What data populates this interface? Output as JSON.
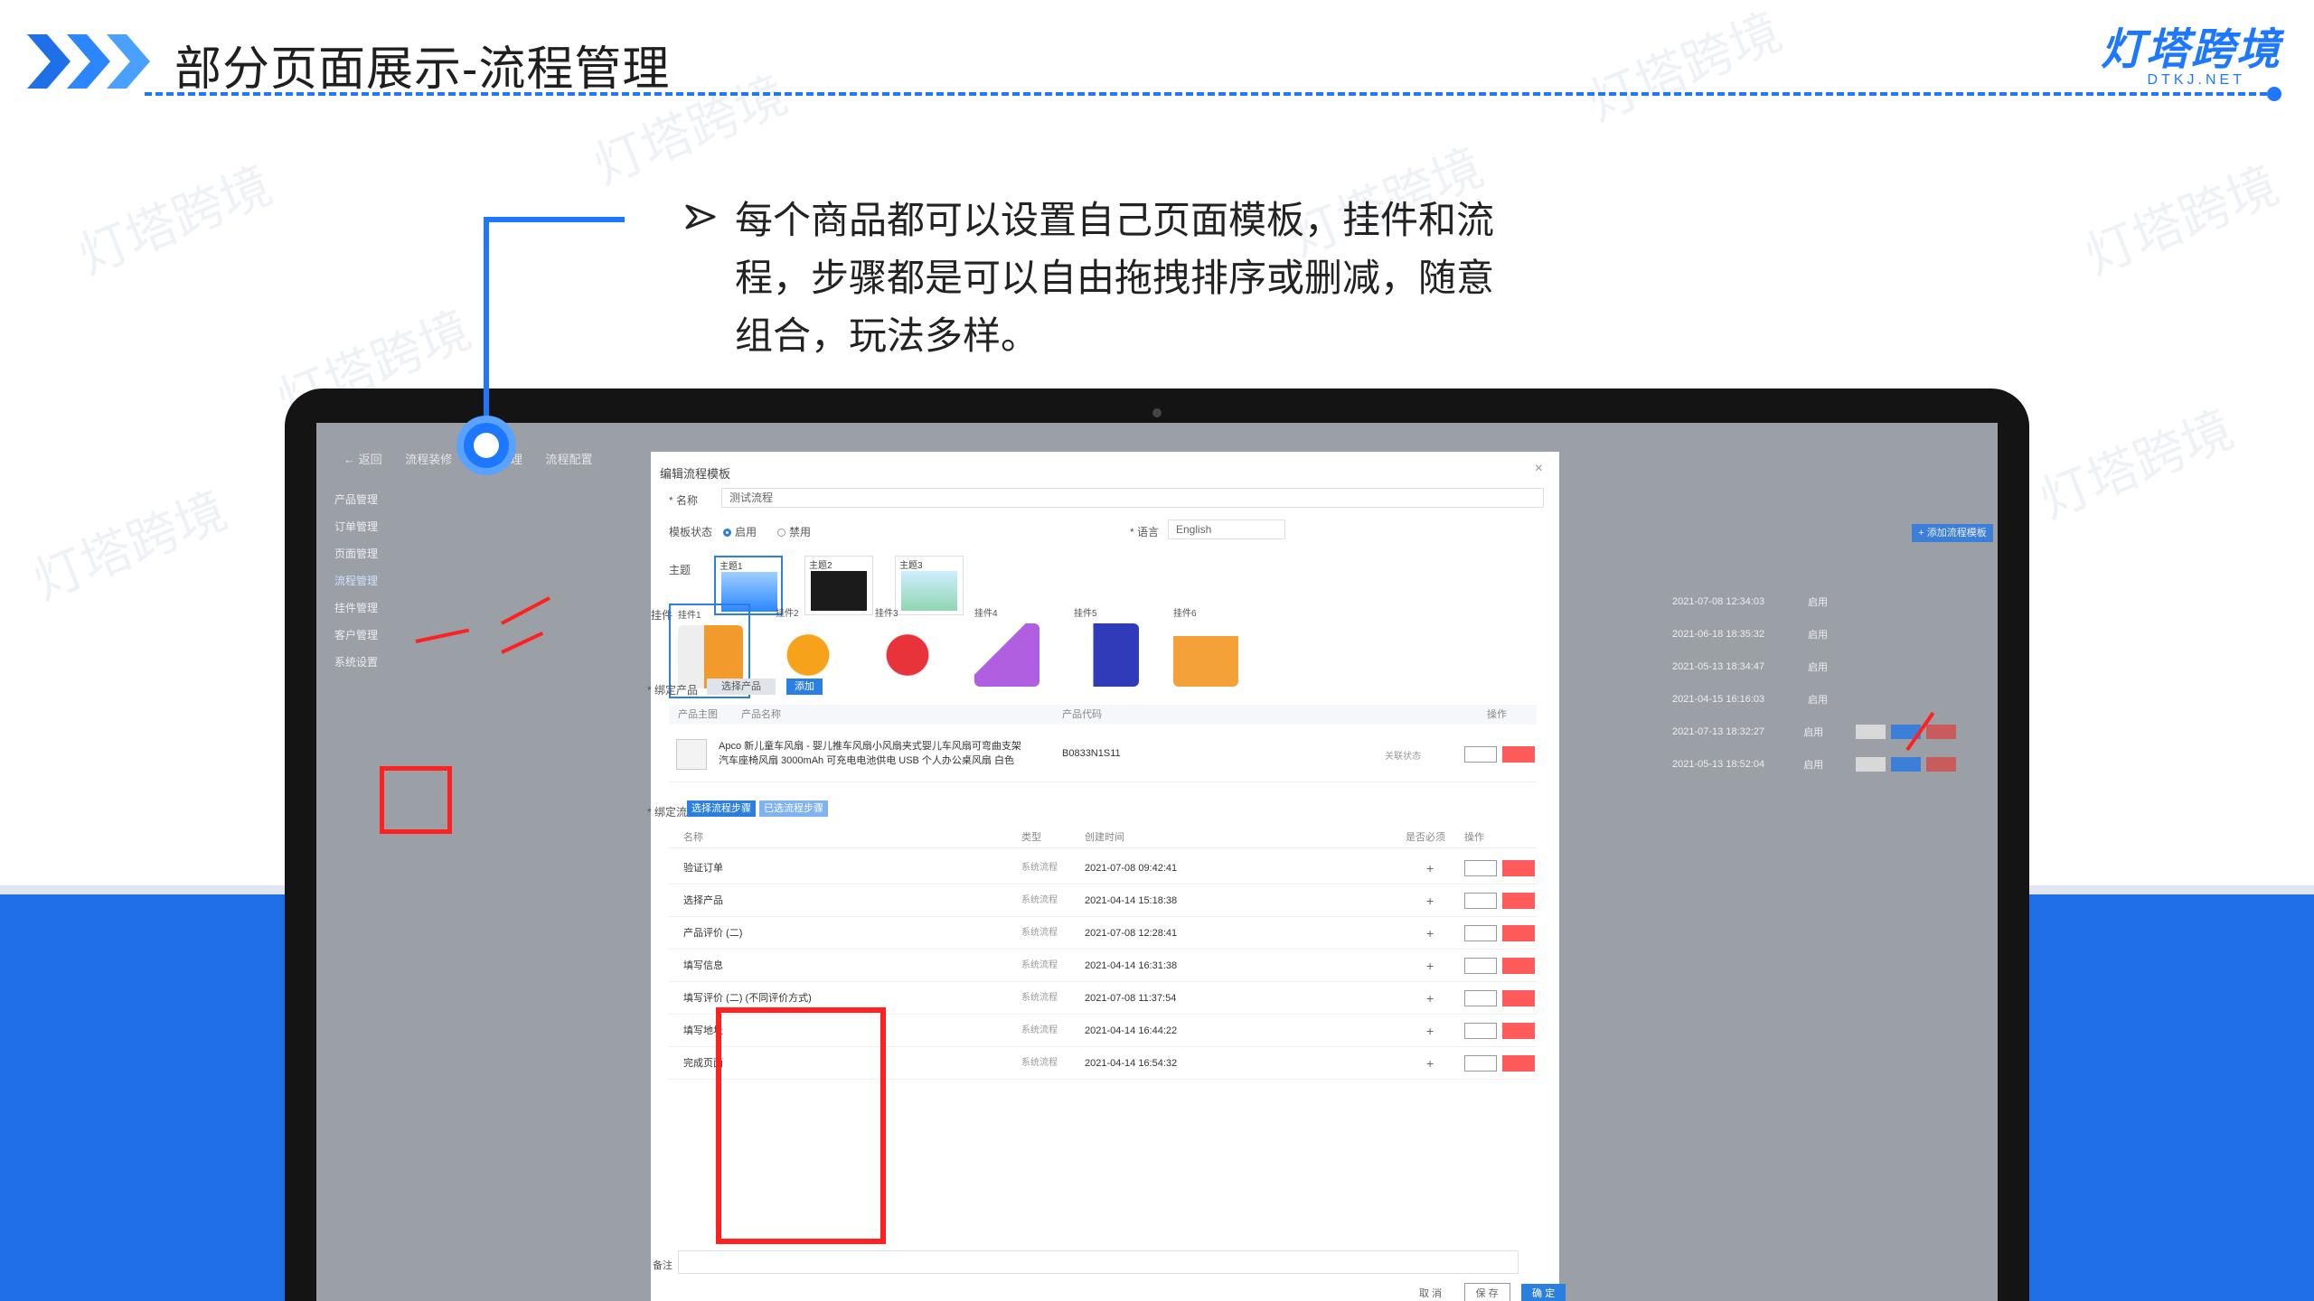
{
  "slide": {
    "title": "部分页面展示-流程管理",
    "brand_name": "灯塔跨境",
    "brand_sub": "DTKJ.NET",
    "watermark": "灯塔跨境",
    "description": "每个商品都可以设置自己页面模板，挂件和流程，步骤都是可以自由拖拽排序或删减，随意组合，玩法多样。"
  },
  "colors": {
    "accent": "#1e78ff",
    "band": "#1e6fe8",
    "highlight": "#ff2020",
    "danger": "#ff5b5b"
  },
  "background_app": {
    "tabs": [
      "← 返回",
      "流程装修",
      "页面管理",
      "流程配置"
    ],
    "sidebar": [
      "产品管理",
      "订单管理",
      "页面管理",
      "流程管理",
      "挂件管理",
      "客户管理",
      "系统设置"
    ],
    "active_sidebar": "流程管理",
    "rows": [
      {
        "time": "2021-07-08 12:34:03",
        "status": "启用"
      },
      {
        "time": "2021-06-18 18:35:32",
        "status": "启用"
      },
      {
        "time": "2021-05-13 18:34:47",
        "status": "启用"
      },
      {
        "time": "2021-04-15 16:16:03",
        "status": "启用"
      },
      {
        "time": "2021-07-13 18:32:27",
        "status": "启用"
      },
      {
        "time": "2021-05-13 18:52:04",
        "status": "启用"
      }
    ],
    "new_button": "+ 添加流程模板"
  },
  "modal": {
    "title": "编辑流程模板",
    "close": "×",
    "name_label": "* 名称",
    "name_value": "测试流程",
    "status_label": "模板状态",
    "status_options": [
      "启用",
      "禁用"
    ],
    "lang_label": "* 语言",
    "lang_value": "English",
    "theme_label": "主题",
    "themes": [
      "主题1",
      "主题2",
      "主题3"
    ],
    "plugin_label": "挂件",
    "plugins": [
      "挂件1",
      "挂件2",
      "挂件3",
      "挂件4",
      "挂件5",
      "挂件6"
    ],
    "product_label": "* 绑定产品",
    "product_tabs": [
      "选择产品",
      "添加"
    ],
    "product_head": [
      "产品主图",
      "产品名称",
      "产品代码",
      "操作"
    ],
    "product": {
      "name": "Apco 新儿童车风扇 - 婴儿推车风扇小风扇夹式婴儿车风扇可弯曲支架汽车座椅风扇 3000mAh 可充电电池供电 USB 个人办公桌风扇 白色",
      "code": "B0833N1S11",
      "state": "关联状态"
    },
    "flow_label": "* 绑定流程",
    "flow_tabs": [
      "选择流程步骤",
      "已选流程步骤"
    ],
    "flow_head": [
      "名称",
      "类型",
      "创建时间",
      "是否必须",
      "操作"
    ],
    "flows": [
      {
        "name": "验证订单",
        "type": "系统流程",
        "date": "2021-07-08 09:42:41"
      },
      {
        "name": "选择产品",
        "type": "系统流程",
        "date": "2021-04-14 15:18:38"
      },
      {
        "name": "产品评价 (二)",
        "type": "系统流程",
        "date": "2021-07-08 12:28:41"
      },
      {
        "name": "填写信息",
        "type": "系统流程",
        "date": "2021-04-14 16:31:38"
      },
      {
        "name": "填写评价 (二) (不同评价方式)",
        "type": "系统流程",
        "date": "2021-07-08 11:37:54"
      },
      {
        "name": "填写地址",
        "type": "系统流程",
        "date": "2021-04-14 16:44:22"
      },
      {
        "name": "完成页面",
        "type": "系统流程",
        "date": "2021-04-14 16:54:32"
      }
    ],
    "remark_label": "备注",
    "buttons": {
      "cancel": "取 消",
      "save": "保 存",
      "confirm": "确 定"
    }
  }
}
